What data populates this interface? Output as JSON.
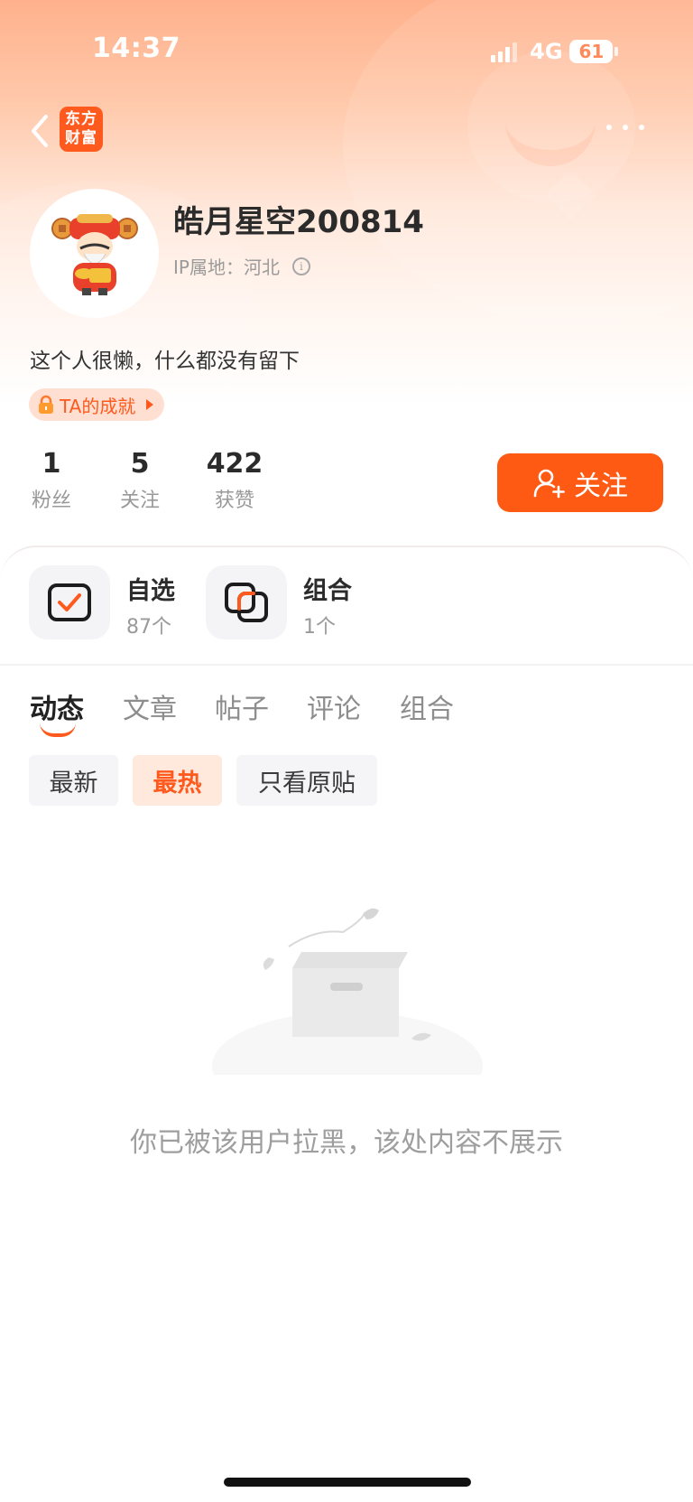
{
  "status_bar": {
    "time": "14:37",
    "network": "4G",
    "battery": "61"
  },
  "header": {
    "logo_line1": "东方",
    "logo_line2": "财富"
  },
  "profile": {
    "username": "皓月星空200814",
    "ip_location": "IP属地：河北",
    "bio": "这个人很懒，什么都没有留下",
    "achievement_label": "TA的成就"
  },
  "stats": [
    {
      "value": "1",
      "label": "粉丝"
    },
    {
      "value": "5",
      "label": "关注"
    },
    {
      "value": "422",
      "label": "获赞"
    }
  ],
  "follow_button": "关注",
  "tools": [
    {
      "title": "自选",
      "subtitle": "87个"
    },
    {
      "title": "组合",
      "subtitle": "1个"
    }
  ],
  "tabs": [
    "动态",
    "文章",
    "帖子",
    "评论",
    "组合"
  ],
  "active_tab": "动态",
  "filters": [
    "最新",
    "最热",
    "只看原贴"
  ],
  "active_filter": "最热",
  "empty_message": "你已被该用户拉黑，该处内容不展示",
  "colors": {
    "accent": "#ff5a1e",
    "text_primary": "#2b2b2b",
    "text_secondary": "#9a9a9a"
  }
}
